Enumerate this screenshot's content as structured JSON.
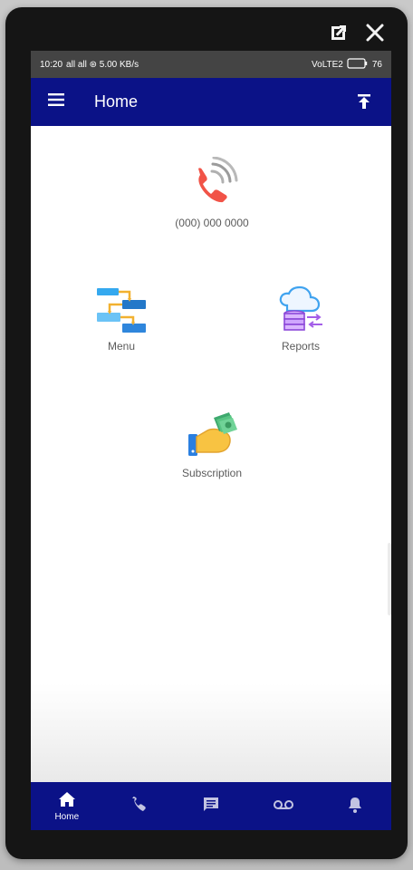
{
  "status_bar": {
    "time": "10:20",
    "left_indicators": "all all ⊛ 5.00 KB/s",
    "right_indicators": "VoLTE2",
    "battery": "76"
  },
  "appbar": {
    "title": "Home"
  },
  "tiles": {
    "phone": {
      "label": "(000) 000 0000"
    },
    "menu": {
      "label": "Menu"
    },
    "reports": {
      "label": "Reports"
    },
    "subscription": {
      "label": "Subscription"
    }
  },
  "bottom_nav": {
    "home_label": "Home"
  },
  "colors": {
    "brand": "#0b1287",
    "statusbar": "#444444"
  }
}
